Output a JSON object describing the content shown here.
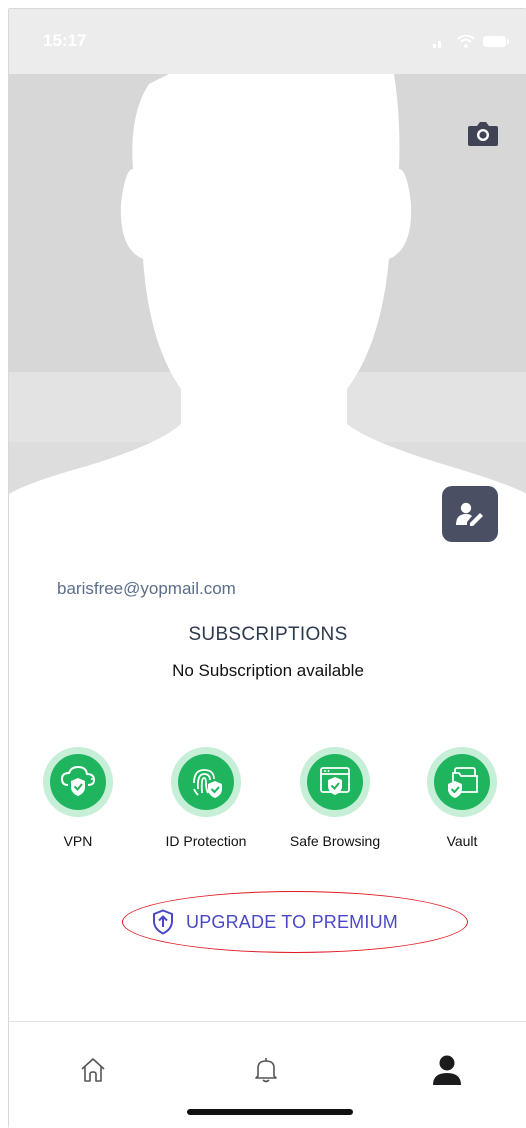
{
  "status_bar": {
    "time": "15:17"
  },
  "profile": {
    "email": "barisfree@yopmail.com",
    "camera_icon": "camera-icon",
    "edit_icon": "edit-profile-icon"
  },
  "subscriptions": {
    "title": "SUBSCRIPTIONS",
    "status": "No Subscription available"
  },
  "features": [
    {
      "label": "VPN",
      "icon": "vpn-cloud-shield-icon"
    },
    {
      "label": "ID Protection",
      "icon": "fingerprint-shield-icon"
    },
    {
      "label": "Safe Browsing",
      "icon": "browser-shield-icon"
    },
    {
      "label": "Vault",
      "icon": "folder-shield-icon"
    }
  ],
  "upgrade": {
    "label": "UPGRADE TO PREMIUM",
    "icon": "shield-arrow-up-icon"
  },
  "tabbar": {
    "items": [
      "home-icon",
      "bell-icon",
      "profile-icon"
    ]
  },
  "colors": {
    "feature_green": "#1fb55e",
    "feature_ring": "#c7eed6",
    "upgrade_text": "#4b48c8",
    "annotation_red": "#e11b22",
    "edit_button": "#4a4f63"
  }
}
